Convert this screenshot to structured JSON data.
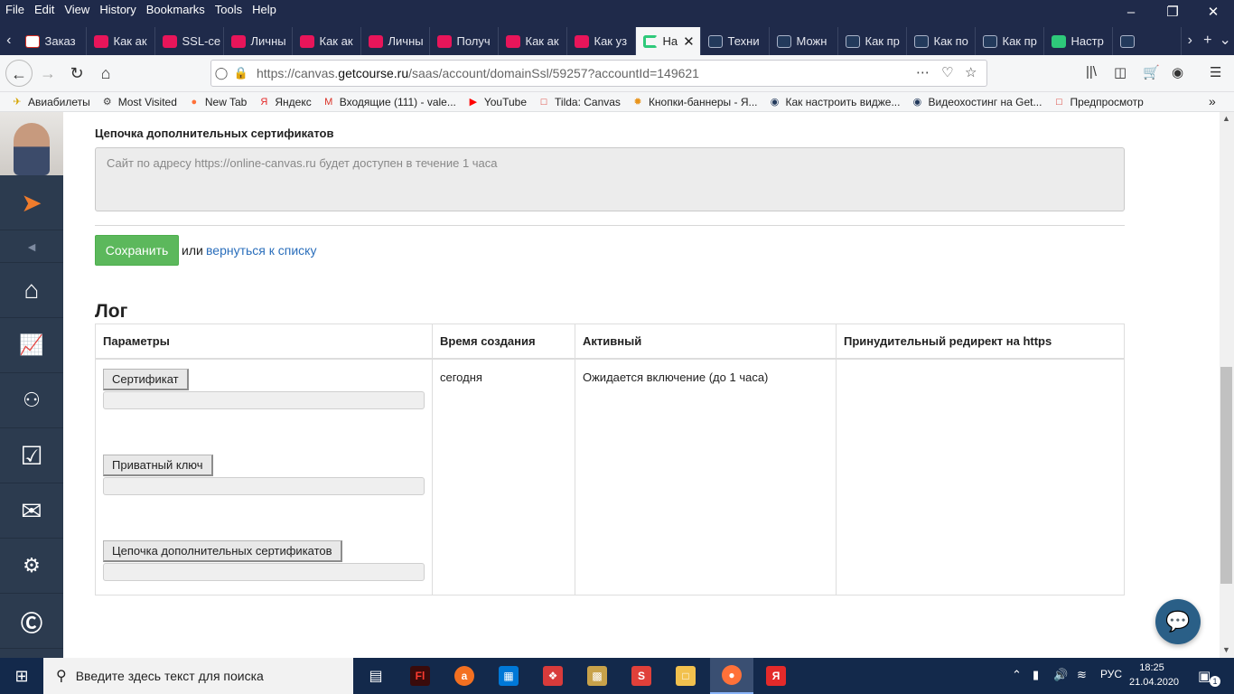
{
  "menubar": {
    "items": [
      "File",
      "Edit",
      "View",
      "History",
      "Bookmarks",
      "Tools",
      "Help"
    ]
  },
  "tabs": [
    {
      "label": "Заказ",
      "fav": "mail"
    },
    {
      "label": "Как ак",
      "fav": "pink"
    },
    {
      "label": "SSL-се",
      "fav": "pink"
    },
    {
      "label": "Личны",
      "fav": "pink"
    },
    {
      "label": "Как ак",
      "fav": "pink"
    },
    {
      "label": "Личны",
      "fav": "pink"
    },
    {
      "label": "Получ",
      "fav": "pink"
    },
    {
      "label": "Как ак",
      "fav": "pink"
    },
    {
      "label": "Как уз",
      "fav": "pink"
    },
    {
      "label": "На",
      "fav": "c",
      "active": true
    },
    {
      "label": "Техни",
      "fav": "gc"
    },
    {
      "label": "Можн",
      "fav": "gc"
    },
    {
      "label": "Как пр",
      "fav": "gc"
    },
    {
      "label": "Как по",
      "fav": "gc"
    },
    {
      "label": "Как пр",
      "fav": "gc"
    },
    {
      "label": "Настр",
      "fav": "cg"
    },
    {
      "label": "",
      "fav": "gc"
    }
  ],
  "urlbar": {
    "prefix": "https://canvas.",
    "domain": "getcourse.ru",
    "suffix": "/saas/account/domainSsl/59257?accountId=149621"
  },
  "bookmarks": [
    {
      "label": "Авиабилеты",
      "icon": "plane-icon"
    },
    {
      "label": "Most Visited",
      "icon": "gear-icon"
    },
    {
      "label": "New Tab",
      "icon": "firefox-icon"
    },
    {
      "label": "Яндекс",
      "icon": "yandex-icon"
    },
    {
      "label": "Входящие (111) - vale...",
      "icon": "gmail-icon"
    },
    {
      "label": "YouTube",
      "icon": "youtube-icon"
    },
    {
      "label": "Tilda: Canvas",
      "icon": "page-icon"
    },
    {
      "label": "Кнопки-баннеры - Я...",
      "icon": "sun-icon"
    },
    {
      "label": "Как настроить видже...",
      "icon": "gc-icon"
    },
    {
      "label": "Видеохостинг на Get...",
      "icon": "gc-icon"
    },
    {
      "label": "Предпросмотр",
      "icon": "page-icon"
    }
  ],
  "form": {
    "chain_label": "Цепочка дополнительных сертификатов",
    "chain_placeholder": "Сайт по адресу https://online-canvas.ru будет доступен в течение 1 часа",
    "save_label": "Сохранить",
    "or_text": "или",
    "back_link": "вернуться к списку"
  },
  "log": {
    "title": "Лог",
    "columns": [
      "Параметры",
      "Время создания",
      "Активный",
      "Принудительный редирект на https"
    ],
    "row": {
      "params": [
        "Сертификат",
        "Приватный ключ",
        "Цепочка дополнительных сертификатов"
      ],
      "created": "сегодня",
      "active": "Ожидается включение (до 1 часа)",
      "redirect": ""
    }
  },
  "taskbar": {
    "search_placeholder": "Введите здесь текст для поиска",
    "lang": "РУС",
    "time": "18:25",
    "date": "21.04.2020",
    "notif_count": "1"
  }
}
